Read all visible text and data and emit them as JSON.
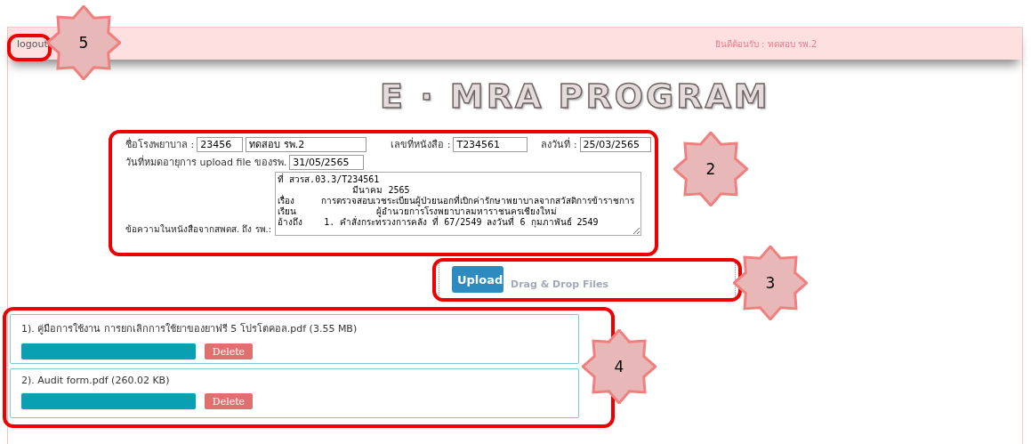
{
  "header": {
    "logout": "logout",
    "welcome": "ยินดีต้อนรับ : ทดสอบ รพ.2"
  },
  "logo": "E · MRA PROGRAM",
  "form": {
    "hospital_label": "ชื่อโรงพยาบาล :",
    "hospital_code": "23456",
    "hospital_name": "ทดสอบ รพ.2",
    "doc_no_label": "เลขที่หนังสือ :",
    "doc_no": "T234561",
    "date_label": "ลงวันที่ :",
    "date": "25/03/2565",
    "expiry_label": "วันที่หมดอายุการ upload file ของรพ.",
    "expiry": "31/05/2565",
    "message_label": "ข้อความในหนังสือจากสพดส. ถึง รพ.:",
    "message_lines": [
      "ที่ สวรส.03.3/T234561",
      "              มีนาคม 2565",
      "เรื่อง     การตรวจสอบเวชระเบียนผู้ป่วยนอกที่เบิกค่ารักษาพยาบาลจากสวัสดิการข้าราชการ",
      "เรียน               ผู้อำนวยการโรงพยาบาลมหาราชนครเชียงใหม่",
      "อ้างถึง    1. คำสั่งกระทรวงการคลัง ที่ 67/2549 ลงวันที่ 6 กุมภาพันธ์ 2549"
    ]
  },
  "upload": {
    "button": "Upload",
    "hint": "Drag & Drop Files"
  },
  "files": [
    {
      "name": "1). คู่มือการใช้งาน การยกเลิกการใช้ยาของยาฟรี 5 โปรโตคอล.pdf (3.55 MB)",
      "level": 1,
      "delete": "Delete"
    },
    {
      "name": "2). Audit form.pdf (260.02 KB)",
      "level": 1,
      "delete": "Delete"
    }
  ],
  "callouts": [
    {
      "label": "5"
    },
    {
      "label": "2"
    },
    {
      "label": "3"
    },
    {
      "label": "4"
    }
  ]
}
